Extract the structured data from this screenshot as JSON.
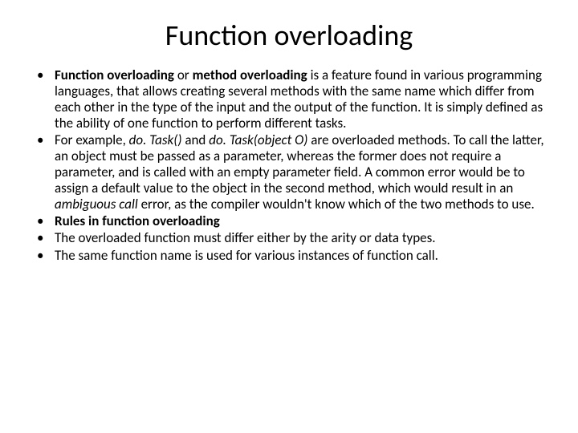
{
  "title": "Function overloading",
  "bullets": {
    "b1_bold": "Function overloading ",
    "b1_text1": "or ",
    "b1_bold2": "method overloading ",
    "b1_text2": "is a feature found in various programming languages, that allows creating several methods with the same name which differ from each other in the type of the input and the output of the function. It is simply defined as the ability of one function to perform different tasks.",
    "b2_text1": "For example, ",
    "b2_italic1": "do. Task() ",
    "b2_text2": "and ",
    "b2_italic2": "do. Task(object O) ",
    "b2_text3": "are overloaded methods. To call the latter, an object must be passed as a parameter, whereas the former does not require a parameter, and is called with an empty parameter field. A common error would be to assign a default value to the object in the second method, which would result in an ",
    "b2_italic3": "ambiguous call ",
    "b2_text4": "error, as the compiler wouldn't know which of the two methods to use.",
    "b3_bold": "Rules in function overloading",
    "b4_text": "The overloaded function must differ either by the arity or data types.",
    "b5_text": "The same function name is used for various instances of function call."
  }
}
